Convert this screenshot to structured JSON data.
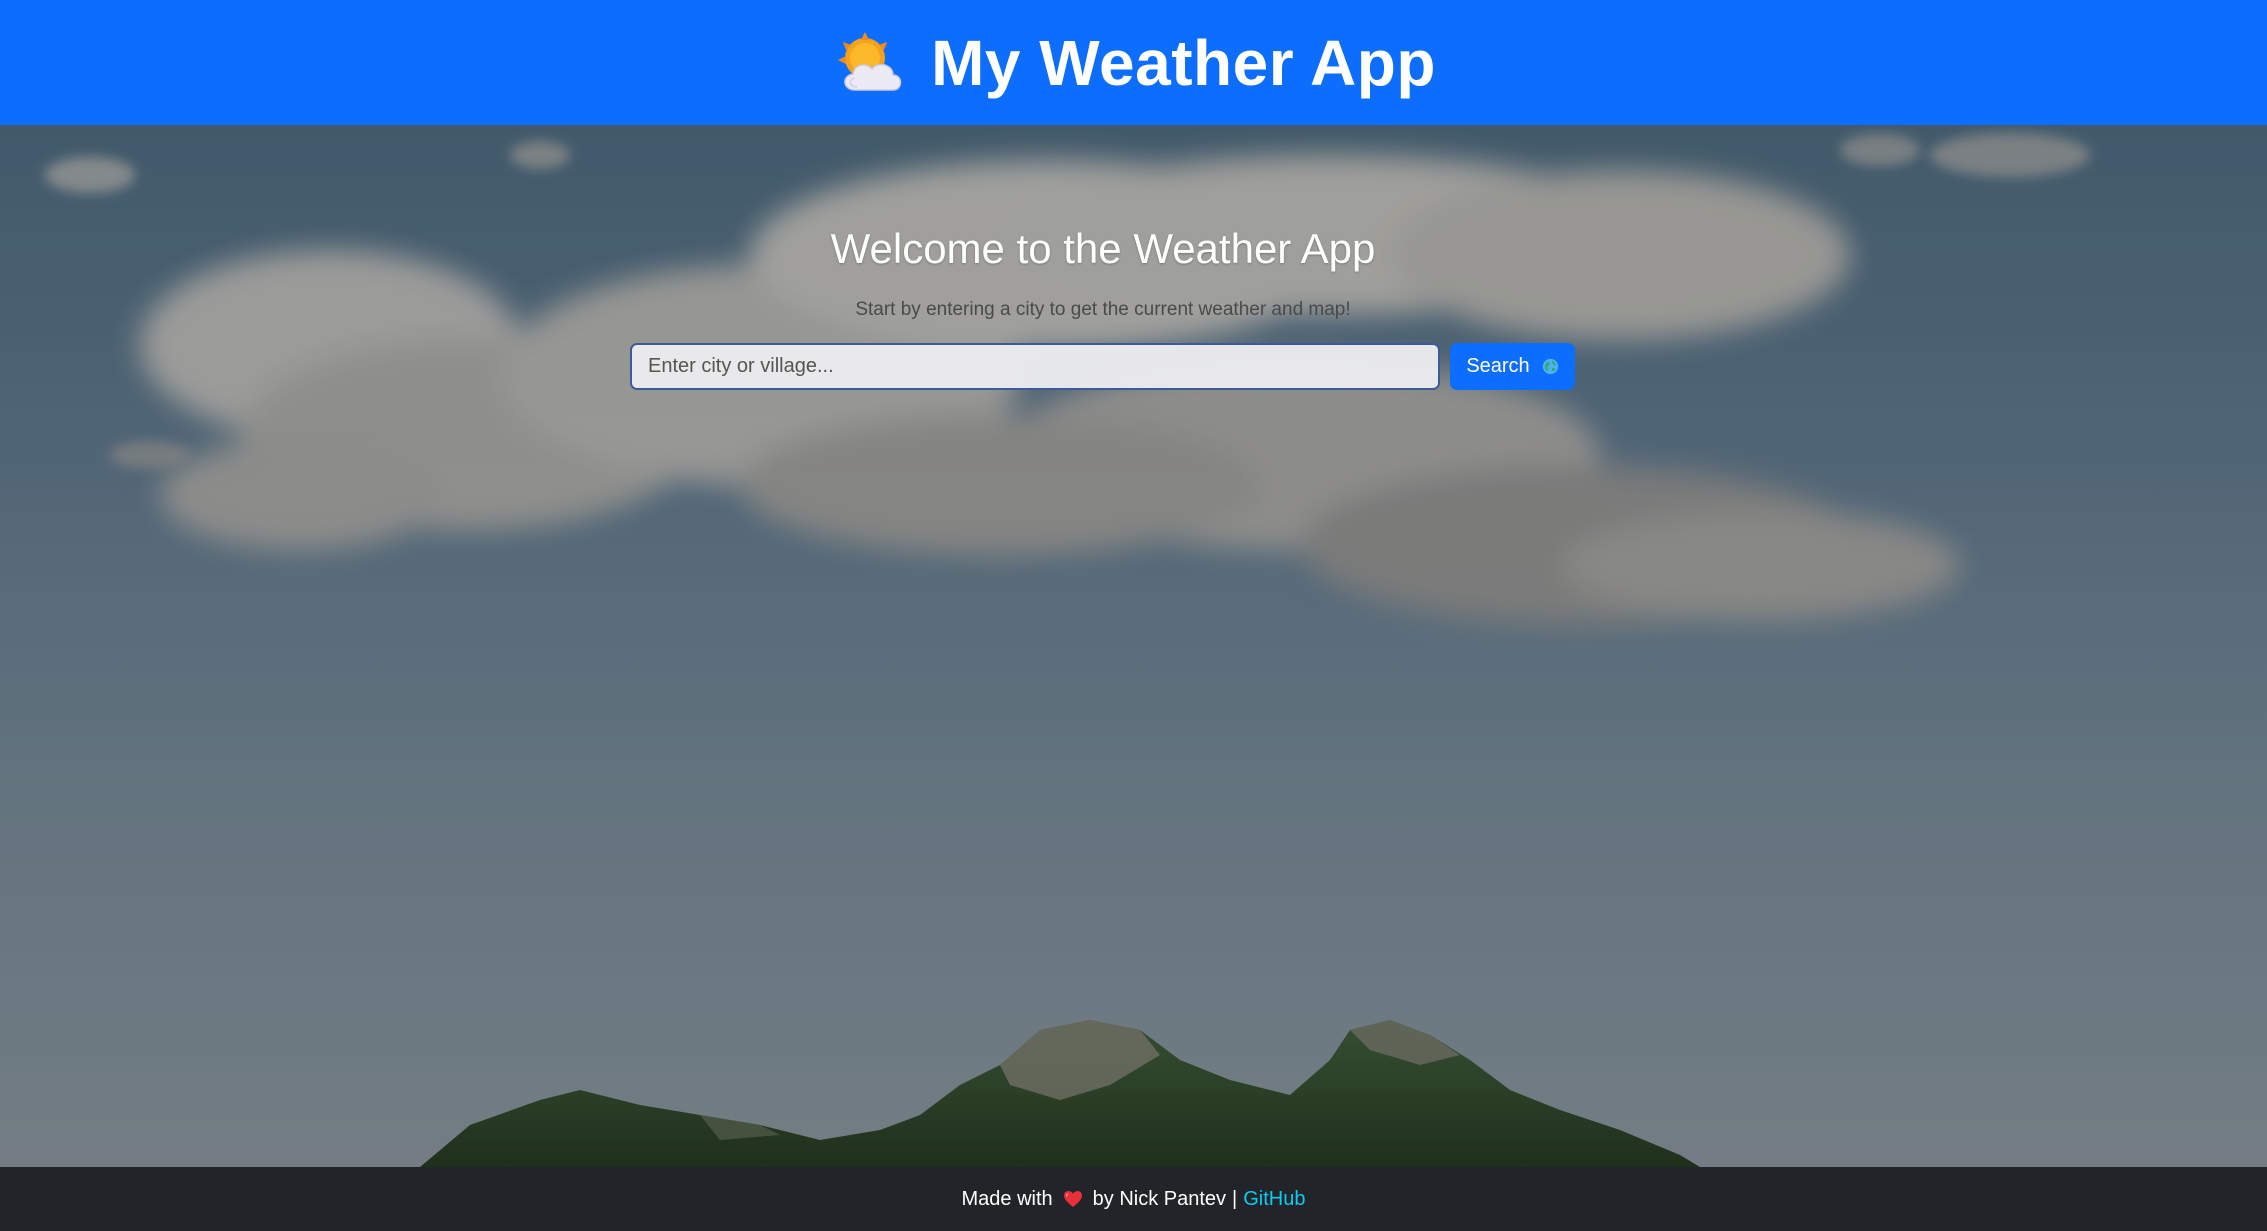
{
  "header": {
    "title": "My Weather App",
    "icon": "sun-behind-cloud-icon"
  },
  "welcome": {
    "title": "Welcome to the Weather App",
    "subtitle": "Start by entering a city to get the current weather and map!"
  },
  "search": {
    "placeholder": "Enter city or village...",
    "value": "",
    "button_label": "Search",
    "button_icon": "globe-icon"
  },
  "footer": {
    "made_with": "Made with",
    "heart_icon": "heart-icon",
    "by": "by Nick Pantev",
    "separator": "|",
    "link_label": "GitHub"
  },
  "colors": {
    "primary": "#0d6efd",
    "footer_bg": "#212529",
    "link": "#0dcaf0"
  }
}
